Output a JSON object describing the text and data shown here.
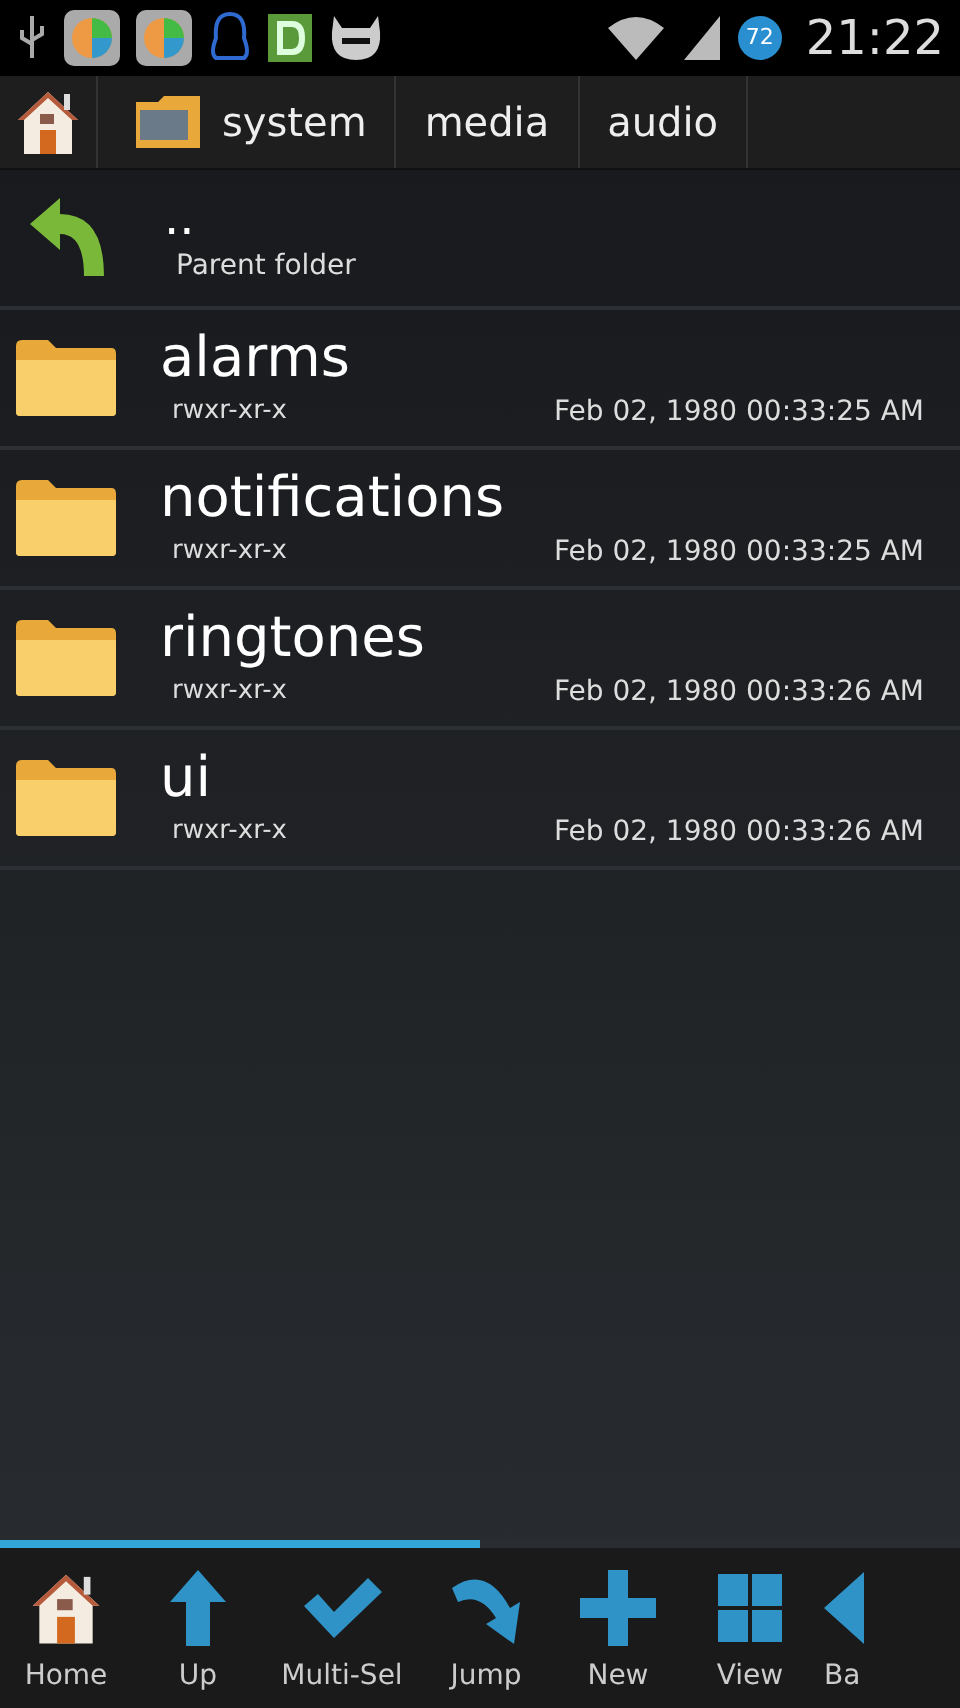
{
  "status_bar": {
    "battery": "72",
    "time": "21:22"
  },
  "breadcrumb": [
    "system",
    "media",
    "audio"
  ],
  "parent": {
    "name": "..",
    "caption": "Parent folder"
  },
  "files": [
    {
      "name": "alarms",
      "permissions": "rwxr-xr-x",
      "modified": "Feb 02, 1980 00:33:25 AM"
    },
    {
      "name": "notifications",
      "permissions": "rwxr-xr-x",
      "modified": "Feb 02, 1980 00:33:25 AM"
    },
    {
      "name": "ringtones",
      "permissions": "rwxr-xr-x",
      "modified": "Feb 02, 1980 00:33:26 AM"
    },
    {
      "name": "ui",
      "permissions": "rwxr-xr-x",
      "modified": "Feb 02, 1980 00:33:26 AM"
    }
  ],
  "toolbar": [
    {
      "kind": "home",
      "label": "Home"
    },
    {
      "kind": "up",
      "label": "Up"
    },
    {
      "kind": "check",
      "label": "Multi-Sel"
    },
    {
      "kind": "jump",
      "label": "Jump"
    },
    {
      "kind": "new",
      "label": "New"
    },
    {
      "kind": "view",
      "label": "View"
    },
    {
      "kind": "back",
      "label": "Ba"
    }
  ]
}
